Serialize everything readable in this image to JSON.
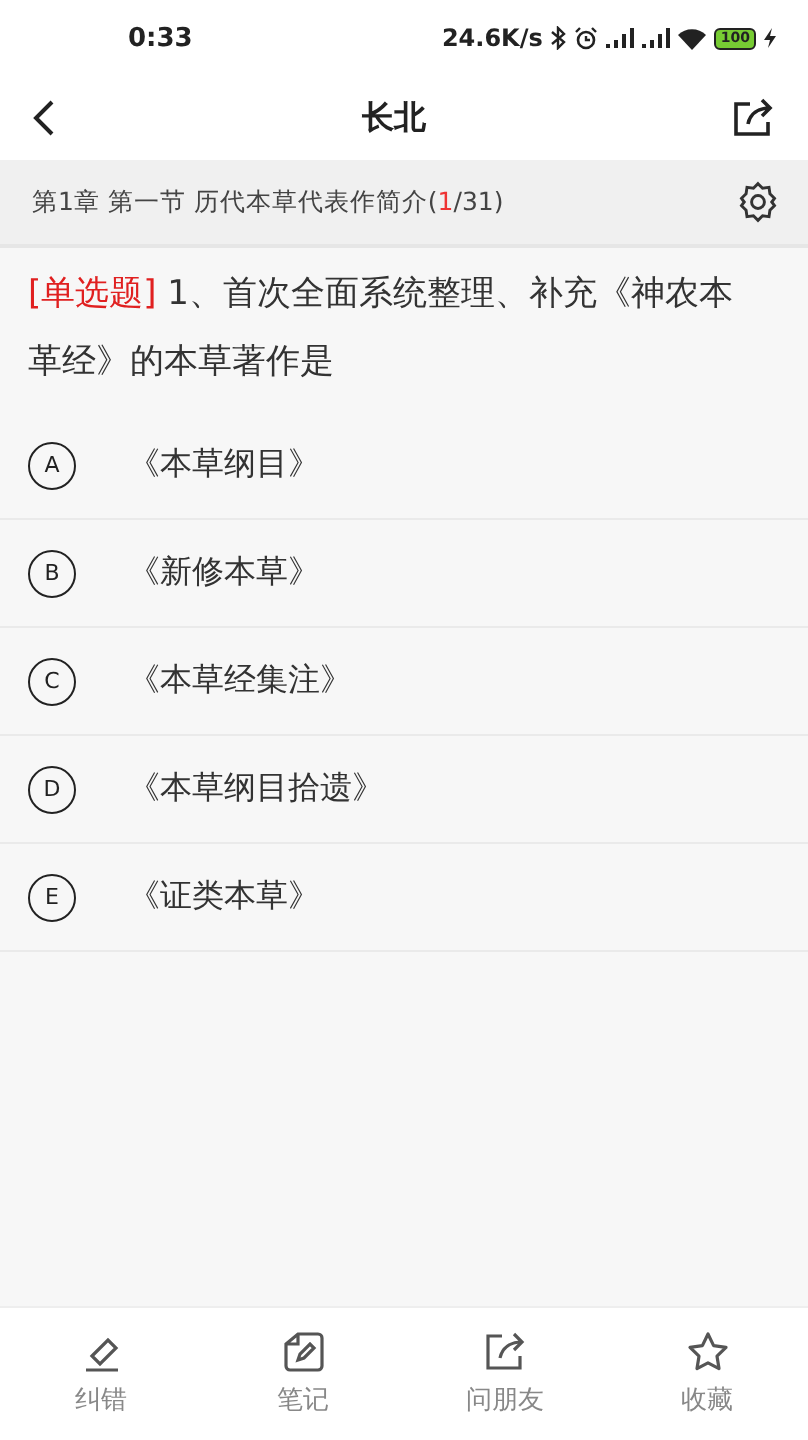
{
  "status_bar": {
    "time": "0:33",
    "speed": "24.6K/s",
    "battery": "100"
  },
  "header": {
    "title": "长北"
  },
  "chapter_bar": {
    "text": "第1章 第一节 历代本草代表作简介(",
    "current": "1",
    "total": "/31)"
  },
  "question": {
    "type_tag": "[单选题]",
    "text": "1、首次全面系统整理、补充《神农本革经》的本草著作是"
  },
  "options": [
    {
      "letter": "A",
      "text": "《本草纲目》",
      "selected": false
    },
    {
      "letter": "B",
      "text": "《新修本草》",
      "selected": false
    },
    {
      "letter": "C",
      "text": "《本草经集注》",
      "selected": false
    },
    {
      "letter": "D",
      "text": "《本草纲目拾遗》",
      "selected": false
    },
    {
      "letter": "E",
      "text": "《证类本草》",
      "selected": false
    }
  ],
  "bottom_bar": [
    {
      "kind": "eraser",
      "label": "纠错"
    },
    {
      "kind": "note",
      "label": "笔记"
    },
    {
      "kind": "share",
      "label": "问朋友"
    },
    {
      "kind": "star",
      "label": "收藏"
    }
  ]
}
